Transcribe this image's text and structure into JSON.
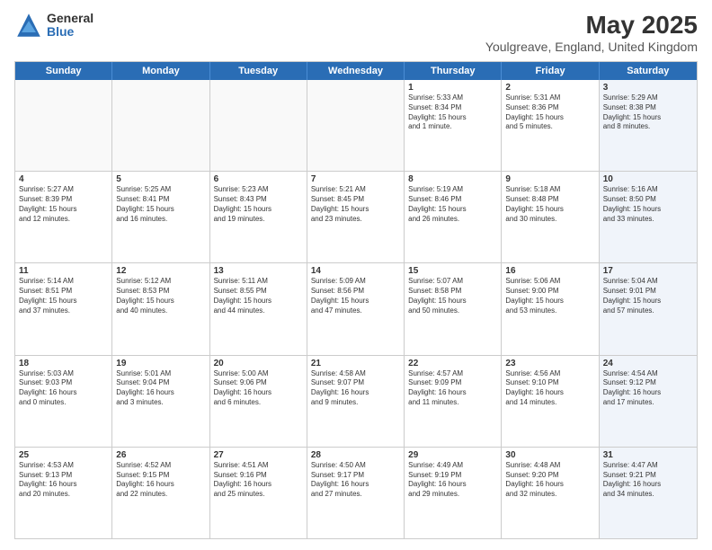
{
  "logo": {
    "general": "General",
    "blue": "Blue"
  },
  "title": "May 2025",
  "subtitle": "Youlgreave, England, United Kingdom",
  "days": [
    "Sunday",
    "Monday",
    "Tuesday",
    "Wednesday",
    "Thursday",
    "Friday",
    "Saturday"
  ],
  "weeks": [
    [
      {
        "day": "",
        "text": "",
        "empty": true
      },
      {
        "day": "",
        "text": "",
        "empty": true
      },
      {
        "day": "",
        "text": "",
        "empty": true
      },
      {
        "day": "",
        "text": "",
        "empty": true
      },
      {
        "day": "1",
        "text": "Sunrise: 5:33 AM\nSunset: 8:34 PM\nDaylight: 15 hours\nand 1 minute."
      },
      {
        "day": "2",
        "text": "Sunrise: 5:31 AM\nSunset: 8:36 PM\nDaylight: 15 hours\nand 5 minutes."
      },
      {
        "day": "3",
        "text": "Sunrise: 5:29 AM\nSunset: 8:38 PM\nDaylight: 15 hours\nand 8 minutes.",
        "shaded": true
      }
    ],
    [
      {
        "day": "4",
        "text": "Sunrise: 5:27 AM\nSunset: 8:39 PM\nDaylight: 15 hours\nand 12 minutes."
      },
      {
        "day": "5",
        "text": "Sunrise: 5:25 AM\nSunset: 8:41 PM\nDaylight: 15 hours\nand 16 minutes."
      },
      {
        "day": "6",
        "text": "Sunrise: 5:23 AM\nSunset: 8:43 PM\nDaylight: 15 hours\nand 19 minutes."
      },
      {
        "day": "7",
        "text": "Sunrise: 5:21 AM\nSunset: 8:45 PM\nDaylight: 15 hours\nand 23 minutes."
      },
      {
        "day": "8",
        "text": "Sunrise: 5:19 AM\nSunset: 8:46 PM\nDaylight: 15 hours\nand 26 minutes."
      },
      {
        "day": "9",
        "text": "Sunrise: 5:18 AM\nSunset: 8:48 PM\nDaylight: 15 hours\nand 30 minutes."
      },
      {
        "day": "10",
        "text": "Sunrise: 5:16 AM\nSunset: 8:50 PM\nDaylight: 15 hours\nand 33 minutes.",
        "shaded": true
      }
    ],
    [
      {
        "day": "11",
        "text": "Sunrise: 5:14 AM\nSunset: 8:51 PM\nDaylight: 15 hours\nand 37 minutes."
      },
      {
        "day": "12",
        "text": "Sunrise: 5:12 AM\nSunset: 8:53 PM\nDaylight: 15 hours\nand 40 minutes."
      },
      {
        "day": "13",
        "text": "Sunrise: 5:11 AM\nSunset: 8:55 PM\nDaylight: 15 hours\nand 44 minutes."
      },
      {
        "day": "14",
        "text": "Sunrise: 5:09 AM\nSunset: 8:56 PM\nDaylight: 15 hours\nand 47 minutes."
      },
      {
        "day": "15",
        "text": "Sunrise: 5:07 AM\nSunset: 8:58 PM\nDaylight: 15 hours\nand 50 minutes."
      },
      {
        "day": "16",
        "text": "Sunrise: 5:06 AM\nSunset: 9:00 PM\nDaylight: 15 hours\nand 53 minutes."
      },
      {
        "day": "17",
        "text": "Sunrise: 5:04 AM\nSunset: 9:01 PM\nDaylight: 15 hours\nand 57 minutes.",
        "shaded": true
      }
    ],
    [
      {
        "day": "18",
        "text": "Sunrise: 5:03 AM\nSunset: 9:03 PM\nDaylight: 16 hours\nand 0 minutes."
      },
      {
        "day": "19",
        "text": "Sunrise: 5:01 AM\nSunset: 9:04 PM\nDaylight: 16 hours\nand 3 minutes."
      },
      {
        "day": "20",
        "text": "Sunrise: 5:00 AM\nSunset: 9:06 PM\nDaylight: 16 hours\nand 6 minutes."
      },
      {
        "day": "21",
        "text": "Sunrise: 4:58 AM\nSunset: 9:07 PM\nDaylight: 16 hours\nand 9 minutes."
      },
      {
        "day": "22",
        "text": "Sunrise: 4:57 AM\nSunset: 9:09 PM\nDaylight: 16 hours\nand 11 minutes."
      },
      {
        "day": "23",
        "text": "Sunrise: 4:56 AM\nSunset: 9:10 PM\nDaylight: 16 hours\nand 14 minutes."
      },
      {
        "day": "24",
        "text": "Sunrise: 4:54 AM\nSunset: 9:12 PM\nDaylight: 16 hours\nand 17 minutes.",
        "shaded": true
      }
    ],
    [
      {
        "day": "25",
        "text": "Sunrise: 4:53 AM\nSunset: 9:13 PM\nDaylight: 16 hours\nand 20 minutes."
      },
      {
        "day": "26",
        "text": "Sunrise: 4:52 AM\nSunset: 9:15 PM\nDaylight: 16 hours\nand 22 minutes."
      },
      {
        "day": "27",
        "text": "Sunrise: 4:51 AM\nSunset: 9:16 PM\nDaylight: 16 hours\nand 25 minutes."
      },
      {
        "day": "28",
        "text": "Sunrise: 4:50 AM\nSunset: 9:17 PM\nDaylight: 16 hours\nand 27 minutes."
      },
      {
        "day": "29",
        "text": "Sunrise: 4:49 AM\nSunset: 9:19 PM\nDaylight: 16 hours\nand 29 minutes."
      },
      {
        "day": "30",
        "text": "Sunrise: 4:48 AM\nSunset: 9:20 PM\nDaylight: 16 hours\nand 32 minutes."
      },
      {
        "day": "31",
        "text": "Sunrise: 4:47 AM\nSunset: 9:21 PM\nDaylight: 16 hours\nand 34 minutes.",
        "shaded": true
      }
    ]
  ]
}
